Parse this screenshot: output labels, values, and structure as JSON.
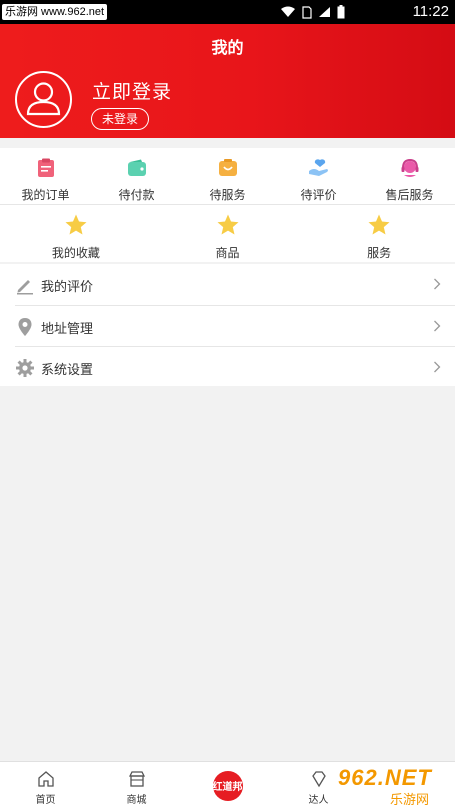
{
  "status_bar": {
    "watermark": "乐游网 www.962.net",
    "time": "11:22"
  },
  "header": {
    "title": "我的",
    "login_title": "立即登录",
    "login_button": "未登录"
  },
  "orders": [
    {
      "label": "我的订单",
      "icon": "clipboard-icon",
      "color": "#f0627a"
    },
    {
      "label": "待付款",
      "icon": "wallet-icon",
      "color": "#5bd1b0"
    },
    {
      "label": "待服务",
      "icon": "service-box-icon",
      "color": "#f5b041"
    },
    {
      "label": "待评价",
      "icon": "hand-heart-icon",
      "color": "#5aa5ee"
    },
    {
      "label": "售后服务",
      "icon": "headset-icon",
      "color": "#ea5aa9"
    }
  ],
  "favorites": [
    {
      "label": "我的收藏",
      "icon": "star-icon"
    },
    {
      "label": "商品",
      "icon": "star-icon"
    },
    {
      "label": "服务",
      "icon": "star-icon"
    }
  ],
  "menu": [
    {
      "label": "我的评价",
      "icon": "pencil-icon"
    },
    {
      "label": "地址管理",
      "icon": "location-pin-icon"
    },
    {
      "label": "系统设置",
      "icon": "gear-icon"
    }
  ],
  "bottom_nav": {
    "home": "首页",
    "mall": "商城",
    "promo_badge": "红道邦",
    "fourth": "达人"
  },
  "watermark_bottom": {
    "big": "962.NET",
    "small": "乐游网"
  },
  "colors": {
    "brand_red": "#e8151a",
    "star": "#f7cc45",
    "watermark_orange": "#f39800"
  }
}
